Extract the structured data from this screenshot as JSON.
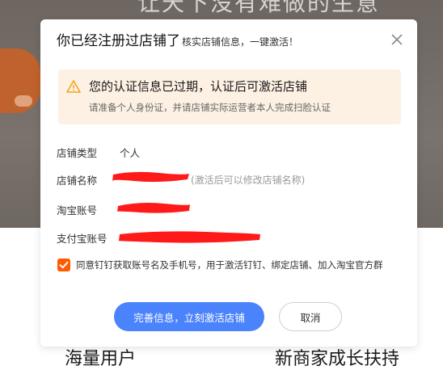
{
  "background": {
    "heading": "让天下没有难做的生意",
    "features": [
      "海量用户",
      "新商家成长扶持"
    ]
  },
  "dialog": {
    "title": "你已经注册过店铺了",
    "subtitle": "核实店铺信息，一键激活！",
    "close_icon": "close-icon",
    "notice": {
      "icon": "warning-icon",
      "title": "您的认证信息已过期，认证后可激活店铺",
      "text": "请准备个人身份证，并请店铺实际运营者本人完成扫脸认证"
    },
    "fields": {
      "store_type": {
        "label": "店铺类型",
        "value": "个人"
      },
      "store_name": {
        "label": "店铺名称",
        "hint": "(激活后可以修改店铺名称)"
      },
      "taobao_account": {
        "label": "淘宝账号"
      },
      "alipay_account": {
        "label": "支付宝账号"
      }
    },
    "agreement": {
      "checked": true,
      "text": "同意钉钉获取账号名及手机号，用于激活钉钉、绑定店铺、加入淘宝官方群"
    },
    "buttons": {
      "primary": "完善信息，立刻激活店铺",
      "cancel": "取消"
    }
  },
  "colors": {
    "primary": "#4a83fb",
    "checkbox": "#ff5a00",
    "notice_bg": "#fdf1e3",
    "warning": "#f4a41f",
    "redaction": "#ff1a1a"
  }
}
